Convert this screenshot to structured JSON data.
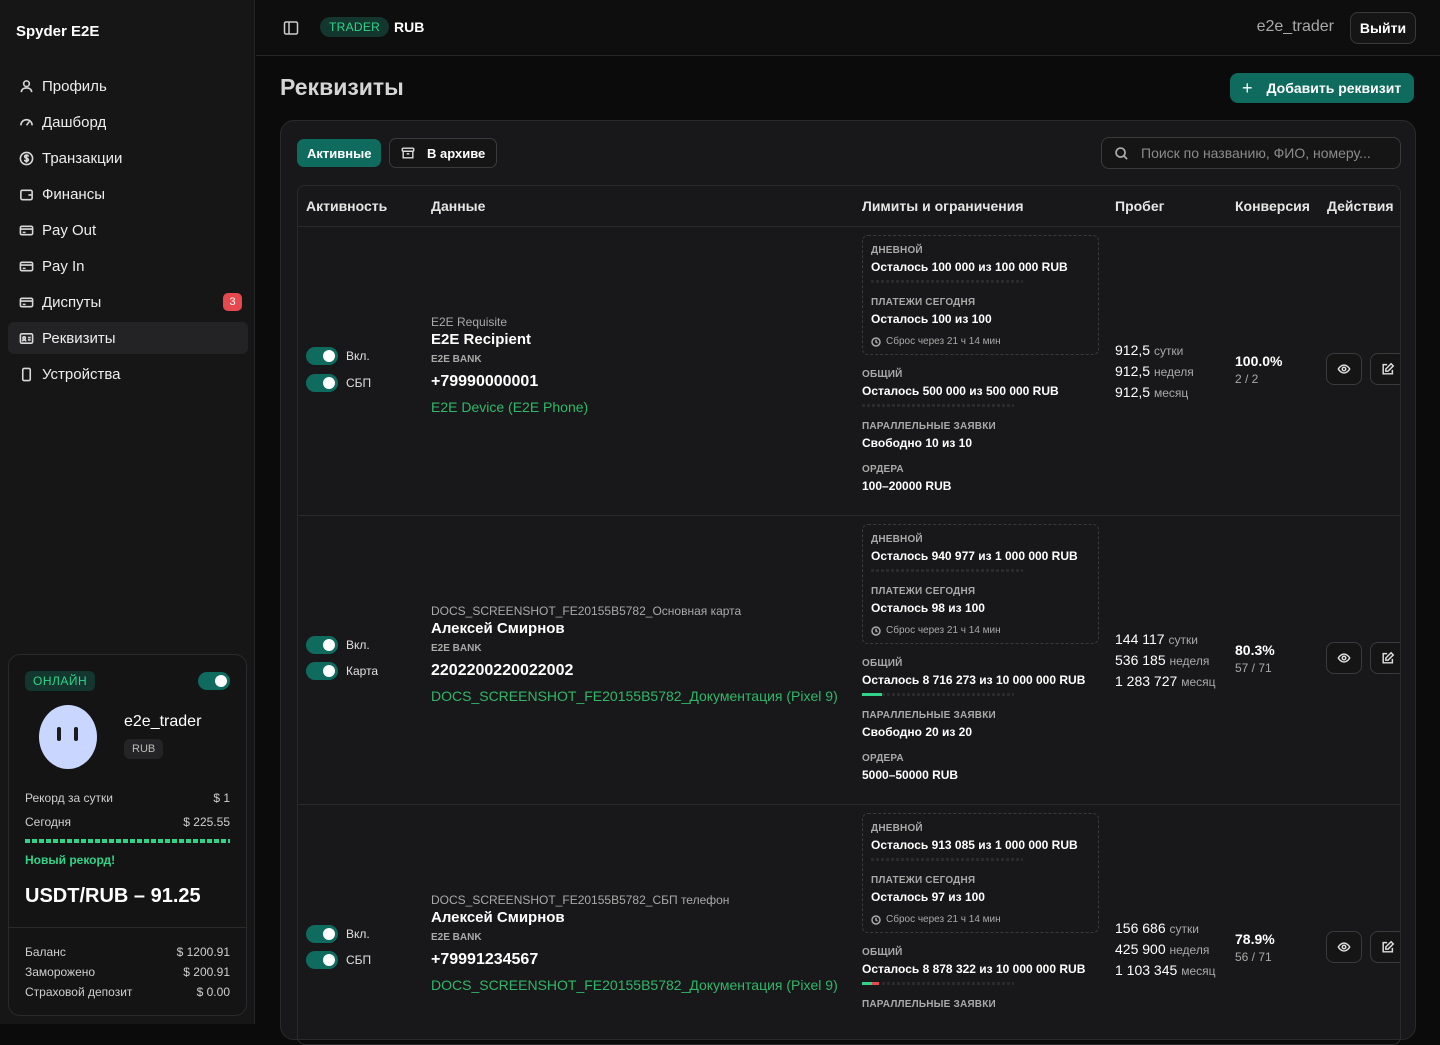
{
  "app": {
    "title": "Spyder E2E"
  },
  "sidebar": {
    "items": [
      {
        "label": "Профиль",
        "icon": "user-icon"
      },
      {
        "label": "Дашборд",
        "icon": "gauge-icon"
      },
      {
        "label": "Транзакции",
        "icon": "dollar-circle-icon"
      },
      {
        "label": "Финансы",
        "icon": "wallet-icon"
      },
      {
        "label": "Pay Out",
        "icon": "card-out-icon"
      },
      {
        "label": "Pay In",
        "icon": "card-in-icon"
      },
      {
        "label": "Диспуты",
        "icon": "card-dispute-icon",
        "badge": "3"
      },
      {
        "label": "Реквизиты",
        "icon": "id-card-icon",
        "active": true
      },
      {
        "label": "Устройства",
        "icon": "phone-icon"
      }
    ]
  },
  "profile_card": {
    "status": "ОНЛАЙН",
    "online": true,
    "username": "e2e_trader",
    "currency": "RUB",
    "record_label": "Рекорд за сутки",
    "record_value": "$ 1",
    "today_label": "Сегодня",
    "today_value": "$ 225.55",
    "new_record": "Новый рекорд!",
    "rate": "USDT/RUB – 91.25",
    "balance_label": "Баланс",
    "balance_value": "$ 1200.91",
    "frozen_label": "Заморожено",
    "frozen_value": "$ 200.91",
    "insurance_label": "Страховой депозит",
    "insurance_value": "$ 0.00"
  },
  "topbar": {
    "role": "TRADER",
    "currency": "RUB",
    "login": "e2e_trader",
    "logout": "Выйти"
  },
  "page": {
    "title": "Реквизиты",
    "add_button": "Добавить реквизит",
    "tab_active": "Активные",
    "tab_archive": "В архиве",
    "search_placeholder": "Поиск по названию, ФИО, номеру..."
  },
  "table": {
    "headers": [
      "Активность",
      "Данные",
      "Лимиты и ограничения",
      "Пробег",
      "Конверсия",
      "Действия"
    ],
    "rows": [
      {
        "toggle1": "Вкл.",
        "toggle2": "СБП",
        "title": "E2E Requisite",
        "name": "E2E Recipient",
        "bank": "E2E BANK",
        "number": "+79990000001",
        "device": "E2E Device (E2E Phone)",
        "daily_h": "ДНЕВНОЙ",
        "daily_v": "Осталось 100 000 из 100 000 RUB",
        "pay_h": "ПЛАТЕЖИ СЕГОДНЯ",
        "pay_v": "Осталось 100 из 100",
        "reset": "Сброс через 21 ч 14 мин",
        "total_h": "ОБЩИЙ",
        "total_v": "Осталось 500 000 из 500 000 RUB",
        "total_used": 0,
        "par_h": "ПАРАЛЛЕЛЬНЫЕ ЗАЯВКИ",
        "par_v": "Свободно 10 из 10",
        "ord_h": "ОРДЕРА",
        "ord_v": "100–20000 RUB",
        "run_day": "912,5",
        "run_week": "912,5",
        "run_month": "912,5",
        "conv": "100.0%",
        "conv_sub": "2 / 2"
      },
      {
        "toggle1": "Вкл.",
        "toggle2": "Карта",
        "title": "DOCS_SCREENSHOT_FE20155B5782_Основная карта",
        "name": "Алексей Смирнов",
        "bank": "E2E BANK",
        "number": "2202200220022002",
        "device": "DOCS_SCREENSHOT_FE20155B5782_Документация (Pixel 9)",
        "daily_h": "ДНЕВНОЙ",
        "daily_v": "Осталось 940 977 из 1 000 000 RUB",
        "pay_h": "ПЛАТЕЖИ СЕГОДНЯ",
        "pay_v": "Осталось 98 из 100",
        "reset": "Сброс через 21 ч 14 мин",
        "total_h": "ОБЩИЙ",
        "total_v": "Осталось 8 716 273 из 10 000 000 RUB",
        "total_used": 0.13,
        "par_h": "ПАРАЛЛЕЛЬНЫЕ ЗАЯВКИ",
        "par_v": "Свободно 20 из 20",
        "ord_h": "ОРДЕРА",
        "ord_v": "5000–50000 RUB",
        "run_day": "144 117",
        "run_week": "536 185",
        "run_month": "1 283 727",
        "conv": "80.3%",
        "conv_sub": "57 / 71"
      },
      {
        "toggle1": "Вкл.",
        "toggle2": "СБП",
        "title": "DOCS_SCREENSHOT_FE20155B5782_СБП телефон",
        "name": "Алексей Смирнов",
        "bank": "E2E BANK",
        "number": "+79991234567",
        "device": "DOCS_SCREENSHOT_FE20155B5782_Документация (Pixel 9)",
        "daily_h": "ДНЕВНОЙ",
        "daily_v": "Осталось 913 085 из 1 000 000 RUB",
        "pay_h": "ПЛАТЕЖИ СЕГОДНЯ",
        "pay_v": "Осталось 97 из 100",
        "reset": "Сброс через 21 ч 14 мин",
        "total_h": "ОБЩИЙ",
        "total_v": "Осталось 8 878 322 из 10 000 000 RUB",
        "total_used": 0.11,
        "par_h": "ПАРАЛЛЕЛЬНЫЕ ЗАЯВКИ",
        "run_day": "156 686",
        "run_week": "425 900",
        "run_month": "1 103 345",
        "conv": "78.9%",
        "conv_sub": "56 / 71"
      }
    ],
    "unit_day": "сутки",
    "unit_week": "неделя",
    "unit_month": "месяц"
  },
  "colors": {
    "accent": "#0e6b5e",
    "green": "#2fd48a",
    "danger": "#e5484d"
  }
}
